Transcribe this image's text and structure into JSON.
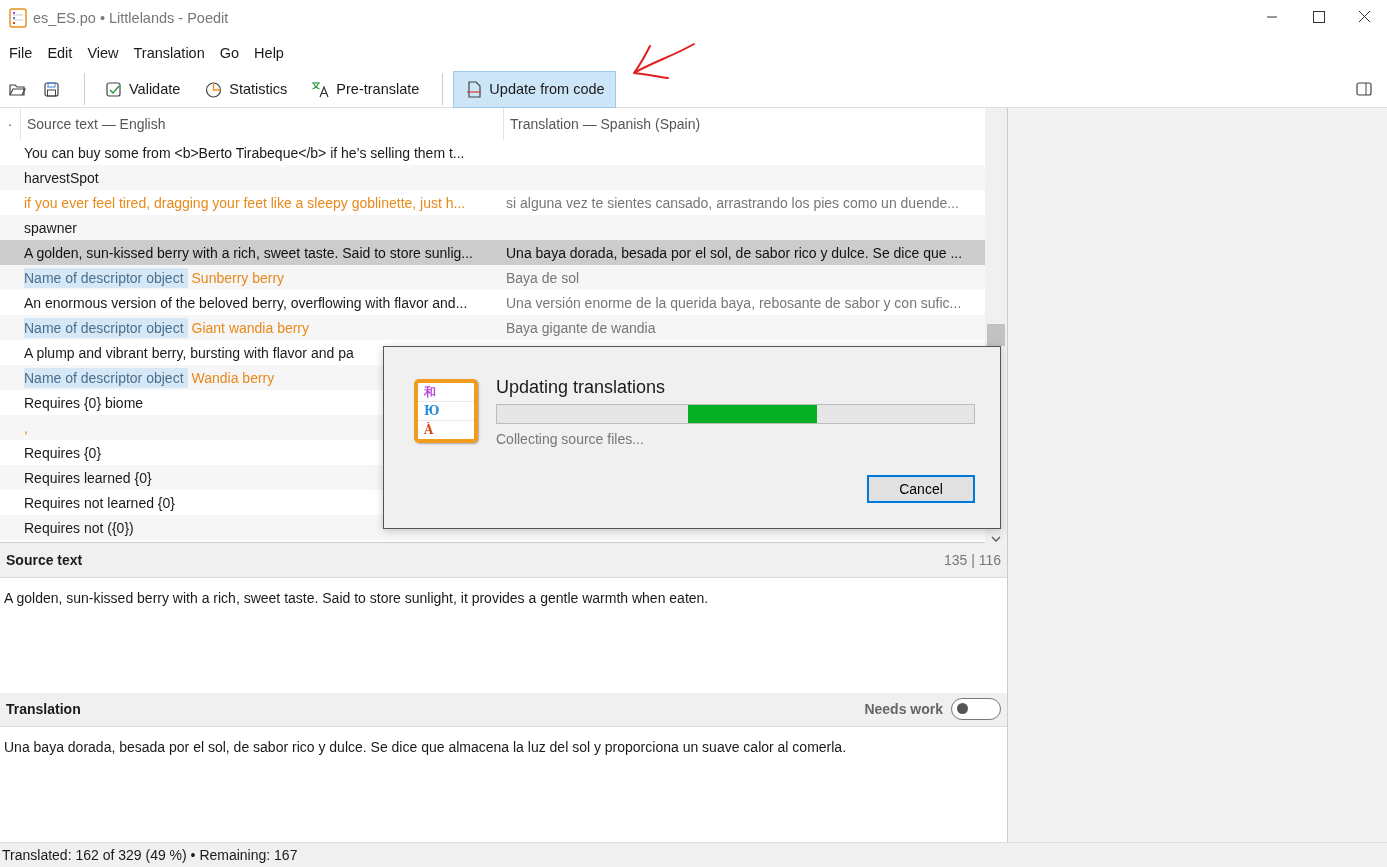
{
  "window": {
    "title": "es_ES.po • Littlelands - Poedit"
  },
  "menu": [
    "File",
    "Edit",
    "View",
    "Translation",
    "Go",
    "Help"
  ],
  "toolbar": [
    {
      "kind": "open"
    },
    {
      "kind": "save"
    },
    {
      "kind": "separator"
    },
    {
      "kind": "validate",
      "label": "Validate",
      "selected": false
    },
    {
      "kind": "statistics",
      "label": "Statistics",
      "selected": false
    },
    {
      "kind": "pretranslate",
      "label": "Pre-translate",
      "selected": false
    },
    {
      "kind": "separator"
    },
    {
      "kind": "update",
      "label": "Update from code",
      "selected": true
    }
  ],
  "table": {
    "columns": [
      "·",
      "Source text — English",
      "Translation — Spanish (Spain)"
    ],
    "rows": [
      {
        "source": "You can buy some from <b>Berto Tirabeque</b> if he’s selling them t...",
        "fuzzy": false,
        "selected": false
      },
      {
        "source": "harvestSpot",
        "fuzzy": false,
        "selected": false
      },
      {
        "source": "if you ever feel tired, dragging your feet like a sleepy goblinette, just h...",
        "translation": "si alguna vez te sientes cansado, arrastrando los pies como un duende...",
        "fuzzy": true,
        "selected": false
      },
      {
        "source": "spawner",
        "fuzzy": false,
        "selected": false
      },
      {
        "source": "A golden, sun-kissed berry with a rich, sweet taste. Said to store sunlig...",
        "translation": "Una baya dorada, besada por el sol, de sabor rico y dulce. Se dice que ...",
        "fuzzy": false,
        "selected": true
      },
      {
        "context": "Name of descriptor object",
        "source": "Sunberry berry",
        "translation": "Baya de sol",
        "fuzzy": true,
        "selected": false
      },
      {
        "source": "An enormous version of the beloved berry, overflowing with flavor and...",
        "translation": "Una versión enorme de la querida baya, rebosante de sabor y con sufic...",
        "fuzzy": false,
        "selected": false
      },
      {
        "context": "Name of descriptor object",
        "source": "Giant wandia berry",
        "translation": "Baya gigante de wandia",
        "fuzzy": true,
        "selected": false
      },
      {
        "source": "A plump and vibrant berry, bursting with flavor and pa",
        "fuzzy": false,
        "selected": false
      },
      {
        "context": "Name of descriptor object",
        "source": "Wandia berry",
        "fuzzy": true,
        "selected": false
      },
      {
        "source": "Requires {0} biome",
        "fuzzy": false,
        "selected": false
      },
      {
        "source": ",",
        "fuzzy": true,
        "selected": false
      },
      {
        "source": "Requires {0}",
        "fuzzy": false,
        "selected": false
      },
      {
        "source": "Requires learned {0}",
        "fuzzy": false,
        "selected": false
      },
      {
        "source": "Requires not learned {0}",
        "fuzzy": false,
        "selected": false
      },
      {
        "source": "Requires not ({0})",
        "fuzzy": false,
        "selected": false
      }
    ]
  },
  "source_pane": {
    "title": "Source text",
    "count": "135 | 116",
    "text": "A golden, sun-kissed berry with a rich, sweet taste. Said to store sunlight, it provides a gentle warmth when eaten."
  },
  "translation_pane": {
    "title": "Translation",
    "needs_work": {
      "label": "Needs work",
      "on": false
    },
    "text": "Una baya dorada, besada por el sol, de sabor rico y dulce. Se dice que almacena la luz del sol y proporciona un suave calor al comerla."
  },
  "status_bar": "Translated: 162 of 329 (49 %)  •  Remaining: 167",
  "dialog": {
    "logo_letters": [
      "和",
      "Ю",
      "À"
    ],
    "title": "Updating translations",
    "progress": {
      "indeterminate": true
    },
    "message": "Collecting source files...",
    "buttons": [
      "Cancel"
    ]
  }
}
